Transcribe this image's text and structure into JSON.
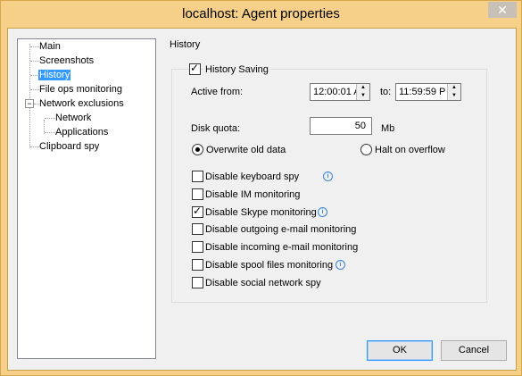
{
  "window": {
    "title": "localhost: Agent properties",
    "close_label": "✕"
  },
  "tree": {
    "items": [
      {
        "label": "Main"
      },
      {
        "label": "Screenshots"
      },
      {
        "label": "History"
      },
      {
        "label": "File ops monitoring"
      },
      {
        "label": "Network exclusions",
        "expander": "−"
      },
      {
        "label": "Network"
      },
      {
        "label": "Applications"
      },
      {
        "label": "Clipboard spy"
      }
    ],
    "selected": "History"
  },
  "history": {
    "section_label": "History",
    "saving_label": "History Saving",
    "saving_checked": true,
    "active_from_label": "Active from:",
    "active_from_value": "12:00:01 A",
    "to_label": "to:",
    "to_value": "11:59:59 P",
    "disk_quota_label": "Disk quota:",
    "disk_quota_value": "50",
    "disk_quota_unit": "Mb",
    "overwrite_label": "Overwrite old data",
    "overwrite_selected": true,
    "halt_label": "Halt on overflow",
    "halt_selected": false,
    "options": [
      {
        "label": "Disable keyboard spy",
        "checked": false,
        "info": true
      },
      {
        "label": "Disable IM monitoring",
        "checked": false,
        "info": false
      },
      {
        "label": "Disable Skype monitoring",
        "checked": true,
        "info": true
      },
      {
        "label": "Disable outgoing e-mail monitoring",
        "checked": false,
        "info": false
      },
      {
        "label": "Disable incoming e-mail monitoring",
        "checked": false,
        "info": false
      },
      {
        "label": "Disable spool files monitoring",
        "checked": false,
        "info": true
      },
      {
        "label": "Disable social network spy",
        "checked": false,
        "info": false
      }
    ],
    "info_glyph": "i",
    "check_glyph": "✓",
    "spin_up_glyph": "▲",
    "spin_down_glyph": "▼"
  },
  "buttons": {
    "ok_label": "OK",
    "cancel_label": "Cancel"
  },
  "colors": {
    "title_bar": "#f6d089",
    "selection": "#3399ff",
    "info": "#3b86d4"
  }
}
